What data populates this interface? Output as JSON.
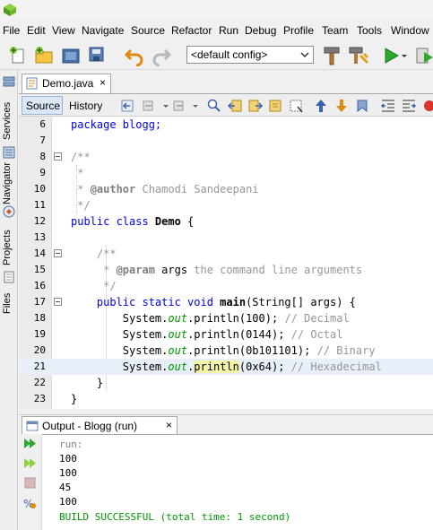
{
  "menu": [
    "File",
    "Edit",
    "View",
    "Navigate",
    "Source",
    "Refactor",
    "Run",
    "Debug",
    "Profile",
    "Team",
    "Tools",
    "Window"
  ],
  "toolbar": {
    "config": "<default config>"
  },
  "side_tabs": [
    "Services",
    "Navigator",
    "Projects",
    "Files"
  ],
  "editor": {
    "tab": "Demo.java",
    "close": "×",
    "source_tab": "Source",
    "history_tab": "History",
    "lines": [
      {
        "n": "6",
        "t1": "package blogg;"
      },
      {
        "n": "7",
        "t1": ""
      },
      {
        "n": "8",
        "t1": "/**"
      },
      {
        "n": "9",
        "t1": " *"
      },
      {
        "n": "10",
        "t1": " * ",
        "tag": "@author",
        "t2": " Chamodi Sandeepani"
      },
      {
        "n": "11",
        "t1": " */"
      },
      {
        "n": "12",
        "kw": "public class ",
        "cls": "Demo",
        "t2": " {"
      },
      {
        "n": "13",
        "t1": ""
      },
      {
        "n": "14",
        "t1": "    /**"
      },
      {
        "n": "15",
        "t1": "     * ",
        "tag": "@param",
        "p": " args",
        "t2": " the command line arguments"
      },
      {
        "n": "16",
        "t1": "     */"
      },
      {
        "n": "17",
        "kw": "    public static void ",
        "cls": "main",
        "t2": "(String[] args) {"
      },
      {
        "n": "18",
        "a": "        System.",
        "f": "out",
        "b": ".println(100); ",
        "c": "// Decimal"
      },
      {
        "n": "19",
        "a": "        System.",
        "f": "out",
        "b": ".println(0144); ",
        "c": "// Octal"
      },
      {
        "n": "20",
        "a": "        System.",
        "f": "out",
        "b": ".println(0b101101); ",
        "c": "// Binary"
      },
      {
        "n": "21",
        "a": "        System.",
        "f": "out",
        "b": ".",
        "h": "println",
        "d": "(0x64); ",
        "c": "// Hexadecimal"
      },
      {
        "n": "22",
        "t1": "    }"
      },
      {
        "n": "23",
        "t1": "}"
      }
    ]
  },
  "output": {
    "tab": "Output - Blogg (run)",
    "close": "×",
    "lines": [
      "run:",
      "100",
      "100",
      "45",
      "100",
      "BUILD SUCCESSFUL (total time: 1 second)"
    ]
  },
  "colors": {
    "keyword": "#0000e6",
    "comment": "#969696",
    "field": "#009900",
    "success": "#009900",
    "current_line": "#e9eff8"
  }
}
